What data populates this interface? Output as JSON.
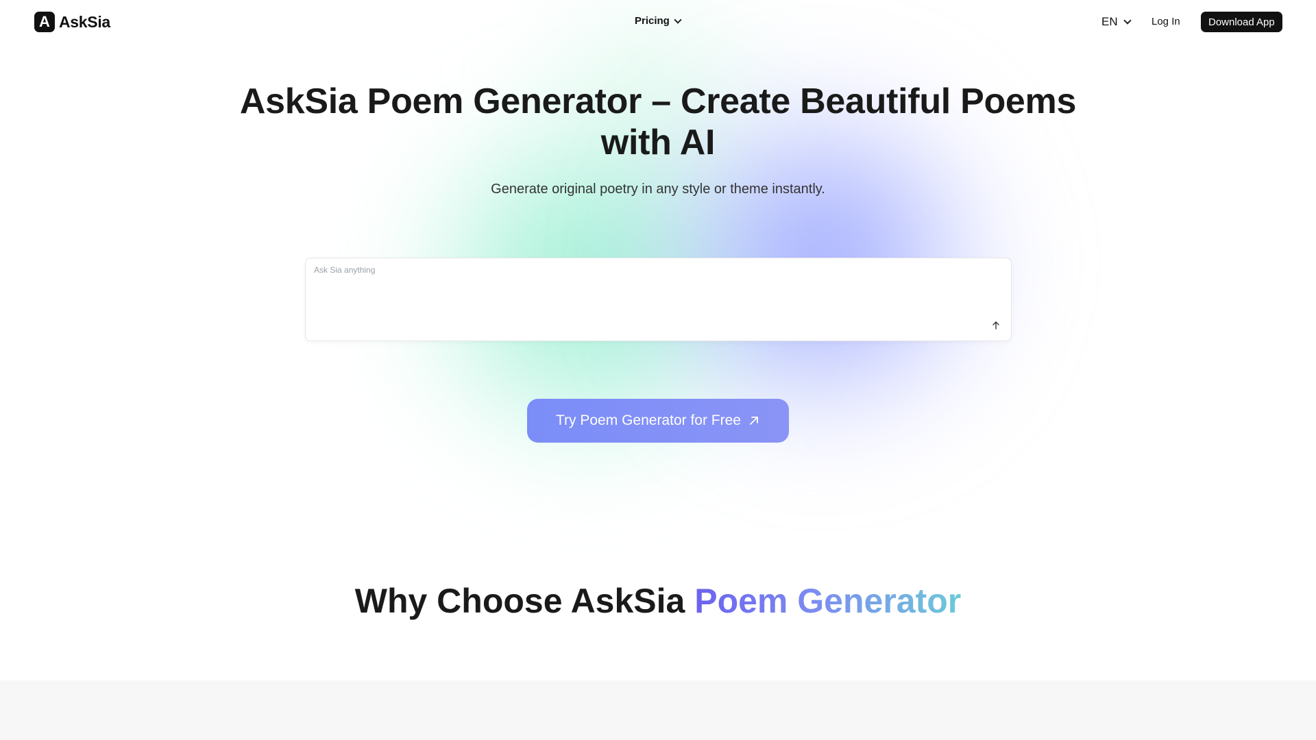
{
  "header": {
    "logo_letter": "A",
    "logo_text": "AskSia",
    "nav_pricing": "Pricing",
    "lang": "EN",
    "login": "Log In",
    "download": "Download App"
  },
  "hero": {
    "title": "AskSia Poem Generator – Create Beautiful Poems with AI",
    "subtitle": "Generate original poetry in any style or theme instantly.",
    "input_placeholder": "Ask Sia anything",
    "input_value": "",
    "cta_label": "Try Poem Generator for Free"
  },
  "why": {
    "prefix": "Why Choose AskSia ",
    "accent": "Poem Generator"
  },
  "colors": {
    "accent_purple": "#6b63ef",
    "accent_teal": "#6cc9d8",
    "cta_bg": "#7b8df8",
    "dark": "#111111"
  },
  "icons": {
    "chevron": "chevron-down-icon",
    "send": "arrow-up-icon",
    "cta": "arrow-up-right-icon"
  }
}
